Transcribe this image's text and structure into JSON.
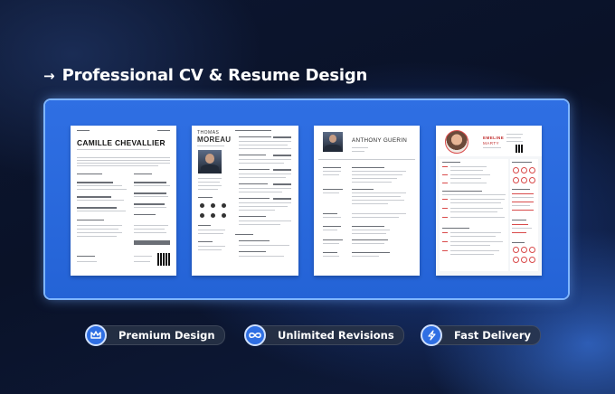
{
  "heading": {
    "arrow": "→",
    "title": "Professional CV & Resume Design"
  },
  "resumes": {
    "card1": {
      "name": "CAMILLE CHEVALLIER"
    },
    "card2": {
      "first": "THOMAS",
      "last": "MOREAU"
    },
    "card3": {
      "name": "ANTHONY GUERIN"
    },
    "card4": {
      "first": "EMELINE",
      "last": "MARTY"
    }
  },
  "badges": [
    {
      "label": "Premium Design",
      "icon": "crown-icon"
    },
    {
      "label": "Unlimited Revisions",
      "icon": "infinity-icon"
    },
    {
      "label": "Fast Delivery",
      "icon": "lightning-icon"
    }
  ],
  "colors": {
    "frame": "#2463d6",
    "accent_red": "#d94a4a",
    "badge_icon": "#2f6fe3"
  }
}
